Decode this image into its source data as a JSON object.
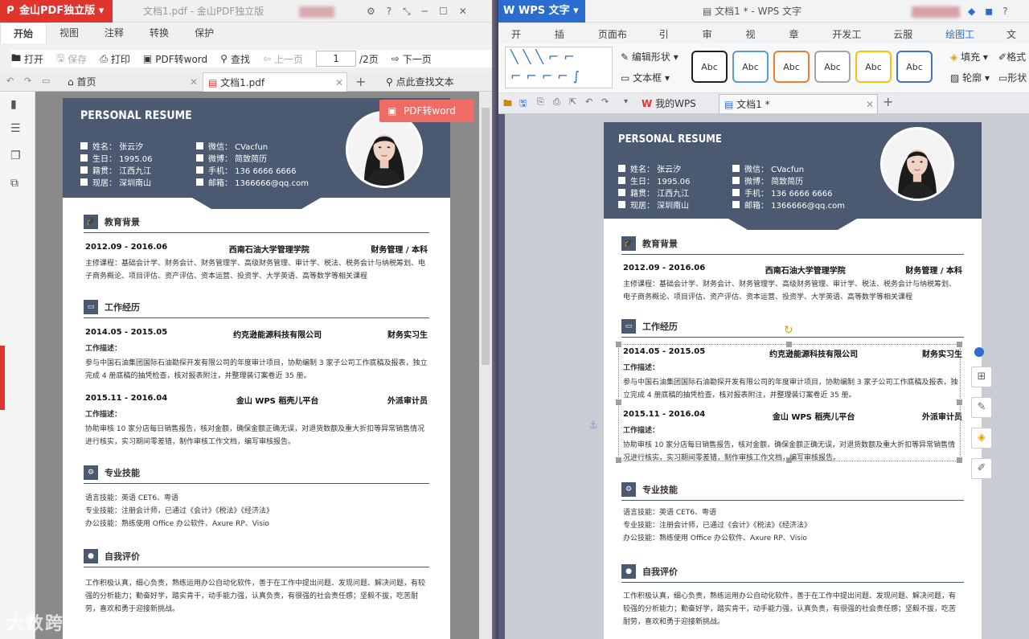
{
  "left": {
    "app_name": "金山PDF独立版",
    "window_title": "文档1.pdf - 金山PDF独立版",
    "menu_tabs": [
      "开始",
      "视图",
      "注释",
      "转换",
      "保护"
    ],
    "toolbar": {
      "open": "打开",
      "save": "保存",
      "print": "打印",
      "pdf2word": "PDF转word",
      "find": "查找",
      "prev": "上一页",
      "page_input": "1",
      "page_total": "/2页",
      "next": "下一页"
    },
    "tabs": {
      "home": "首页",
      "doc": "文档1.pdf",
      "search": "点此查找文本"
    },
    "pdf2word_float": "PDF转word"
  },
  "right": {
    "app_name": "WPS 文字",
    "window_title": "文档1 * - WPS 文字",
    "menu_tabs": [
      "开始",
      "插入",
      "页面布局",
      "引用",
      "审阅",
      "视图",
      "章节",
      "开发工具",
      "云服务",
      "绘图工具",
      "文"
    ],
    "ribbon": {
      "edit_shape": "编辑形状",
      "text_box": "文本框",
      "fill": "填充",
      "outline": "轮廓",
      "format": "格式",
      "shape": "形状",
      "style_label": "Abc"
    },
    "tabs": {
      "mywps": "我的WPS",
      "doc": "文档1 *"
    }
  },
  "resume": {
    "title": "PERSONAL RESUME",
    "info_left": [
      "姓名：   张云汐",
      "生日：   1995.06",
      "籍贯：   江西九江",
      "现居：   深圳南山"
    ],
    "info_right": [
      "微信：   CVacfun",
      "微博：   简致简历",
      "手机：   136 6666 6666",
      "邮箱：   1366666@qq.com"
    ],
    "sections": {
      "edu": "教育背景",
      "work": "工作经历",
      "skills": "专业技能",
      "self": "自我评价"
    },
    "edu": {
      "date": "2012.09 - 2016.06",
      "school": "西南石油大学管理学院",
      "major": "财务管理 / 本科",
      "courses": "主修课程：基础会计学、财务会计、财务管理学、高级财务管理、审计学、税法、税务会计与纳税筹划、电子商务概论、项目评估、资产评估、资本运营、投资学、大学英语、高等数学等相关课程"
    },
    "work1": {
      "date": "2014.05 - 2015.05",
      "company": "约克逊能源科技有限公司",
      "role": "财务实习生",
      "label": "工作描述：",
      "desc": "参与中国石油集团国际石油勘探开发有限公司的年度审计项目，协助编制 3 家子公司工作底稿及报表，独立完成 4 册底稿的抽凭检查，核对报表附注，并整理装订案卷近 35 册。"
    },
    "work2": {
      "date": "2015.11 - 2016.04",
      "company": "金山 WPS 稻壳儿平台",
      "role": "外派审计员",
      "label": "工作描述：",
      "desc": "协助审核 10 家分店每日销售报告，核对金额，确保金额正确无误，对退货数额及重大折扣等异常销售情况进行核实，实习期间零差错，制作审核工作文档，编写审核报告。"
    },
    "skills": [
      "语言技能：英语 CET6、粤语",
      "专业技能：注册会计师，已通过《会计》《税法》《经济法》",
      "办公技能：熟练使用 Office 办公软件、Axure RP、Visio"
    ],
    "self_eval": "工作积极认真，细心负责，熟练运用办公自动化软件，善于在工作中提出问题、发现问题、解决问题，有较强的分析能力；勤奋好学，踏实肯干，动手能力强，认真负责，有很强的社会责任感；坚毅不拔，吃苦耐劳，喜欢和勇于迎接新挑战。"
  },
  "watermark": "大数跨境",
  "colors": {
    "pdf_red": "#e0342f",
    "wps_blue": "#2b6ccf",
    "resume_header": "#4b5a70"
  }
}
